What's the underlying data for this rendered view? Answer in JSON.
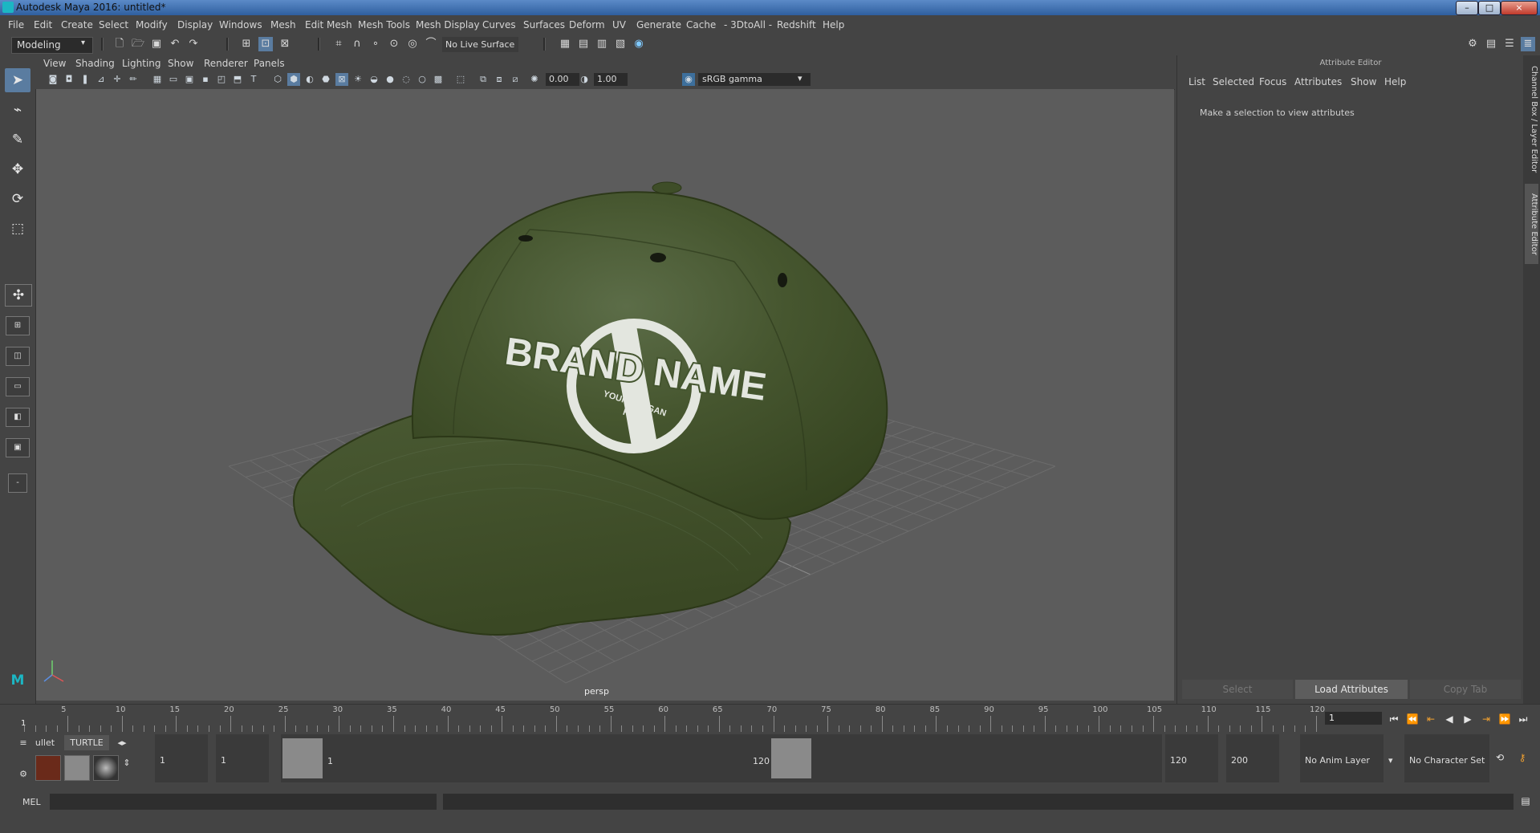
{
  "window": {
    "title": "Autodesk Maya 2016: untitled*",
    "controls": {
      "minimize": "–",
      "maximize": "□",
      "close": "×"
    }
  },
  "menubar": [
    "File",
    "Edit",
    "Create",
    "Select",
    "Modify",
    "Display",
    "Windows",
    "Mesh",
    "Edit Mesh",
    "Mesh Tools",
    "Mesh Display",
    "Curves",
    "Surfaces",
    "Deform",
    "UV",
    "Generate",
    "Cache",
    "- 3DtoAll -",
    "Redshift",
    "Help"
  ],
  "statusline": {
    "mode": "Modeling",
    "live_surface": "No Live Surface"
  },
  "viewport": {
    "menu": [
      "View",
      "Shading",
      "Lighting",
      "Show",
      "Renderer",
      "Panels"
    ],
    "exposure": "0.00",
    "gamma": "1.00",
    "color_space": "sRGB gamma",
    "camera_label": "persp",
    "logo": {
      "line1": "BRAND NAME",
      "line2": "YOUR SLOGAN",
      "line3": "HERE"
    },
    "colors": {
      "background": "#5c5c5c",
      "grid": "#6c6c6c",
      "cap": "#44552f",
      "logo": "#e3e6df"
    }
  },
  "attribute_editor": {
    "title": "Attribute Editor",
    "menu": [
      "List",
      "Selected",
      "Focus",
      "Attributes",
      "Show",
      "Help"
    ],
    "hint": "Make a selection to view attributes",
    "buttons": {
      "select": "Select",
      "load": "Load Attributes",
      "copy": "Copy Tab"
    },
    "side_tabs": [
      "Channel Box / Layer Editor",
      "Attribute Editor"
    ]
  },
  "timeline": {
    "ticks": [
      5,
      10,
      15,
      20,
      25,
      30,
      35,
      40,
      45,
      50,
      55,
      60,
      65,
      70,
      75,
      80,
      85,
      90,
      95,
      100,
      105,
      110,
      115,
      120
    ],
    "start_label": "1",
    "current_frame": "1"
  },
  "range": {
    "shelf_tabs": [
      "ullet",
      "TURTLE"
    ],
    "start_time": "1",
    "playback_start": "1",
    "range_start": "1",
    "range_end": "120",
    "playback_end": "120",
    "end_time": "200",
    "anim_layer": "No Anim Layer",
    "character_set": "No Character Set"
  },
  "command_line": {
    "label": "MEL"
  }
}
